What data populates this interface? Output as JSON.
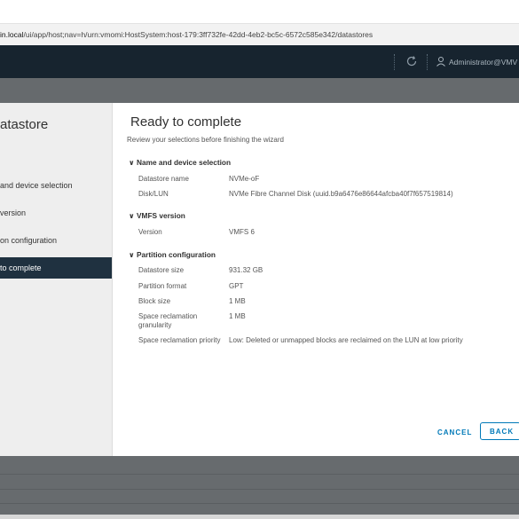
{
  "browser": {
    "url_host": "in.local",
    "url_path": "/ui/app/host;nav=h/urn:vmomi:HostSystem:host-179:3ff732fe-42dd-4eb2-bc5c-6572c585e342/datastores"
  },
  "header": {
    "user": "Administrator@VMV"
  },
  "wizard": {
    "title": "atastore",
    "steps": [
      {
        "label": " and device selection"
      },
      {
        "label": "version"
      },
      {
        "label": "on configuration"
      },
      {
        "label": "to complete"
      }
    ],
    "active_step": 3
  },
  "content": {
    "title": "Ready to complete",
    "subtitle": "Review your selections before finishing the wizard",
    "sections": [
      {
        "heading": "Name and device selection",
        "rows": [
          {
            "label": "Datastore name",
            "value": "NVMe-oF"
          },
          {
            "label": "Disk/LUN",
            "value": "NVMe Fibre Channel Disk (uuid.b9a6476e86644afcba40f7f657519814)"
          }
        ]
      },
      {
        "heading": "VMFS version",
        "rows": [
          {
            "label": "Version",
            "value": "VMFS 6"
          }
        ]
      },
      {
        "heading": "Partition configuration",
        "rows": [
          {
            "label": "Datastore size",
            "value": "931.32 GB"
          },
          {
            "label": "Partition format",
            "value": "GPT"
          },
          {
            "label": "Block size",
            "value": "1 MB"
          },
          {
            "label": "Space reclamation granularity",
            "value": "1 MB"
          },
          {
            "label": "Space reclamation priority",
            "value": "Low: Deleted or unmapped blocks are reclaimed on the LUN at low priority"
          }
        ]
      }
    ]
  },
  "buttons": {
    "cancel": "CANCEL",
    "back": "BACK"
  },
  "colors": {
    "header_bg": "#17242f",
    "active_step_bg": "#1f3140",
    "link": "#0079b8",
    "overlay": "#666a6d"
  }
}
